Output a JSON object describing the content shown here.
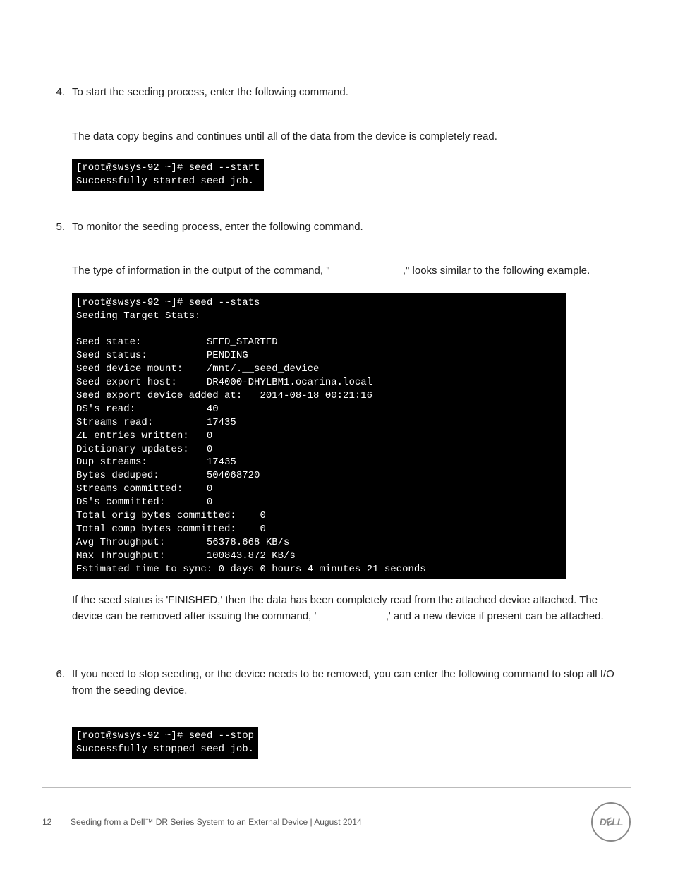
{
  "steps": [
    {
      "num": "4.",
      "intro": "To start the seeding process, enter the following command.",
      "note": "The data copy begins and continues until all of the data from the device is completely read.",
      "terminal": "[root@swsys-92 ~]# seed --start\nSuccessfully started seed job."
    },
    {
      "num": "5.",
      "intro": "To monitor the seeding process, enter the following command.",
      "note_pre": "The type of information in the output of the command, \"",
      "note_post": ",\" looks similar to the following example.",
      "terminal": "[root@swsys-92 ~]# seed --stats\nSeeding Target Stats:\n\nSeed state:           SEED_STARTED\nSeed status:          PENDING\nSeed device mount:    /mnt/.__seed_device\nSeed export host:     DR4000-DHYLBM1.ocarina.local\nSeed export device added at:   2014-08-18 00:21:16\nDS's read:            40\nStreams read:         17435\nZL entries written:   0\nDictionary updates:   0\nDup streams:          17435\nBytes deduped:        504068720\nStreams committed:    0\nDS's committed:       0\nTotal orig bytes committed:    0\nTotal comp bytes committed:    0\nAvg Throughput:       56378.668 KB/s\nMax Throughput:       100843.872 KB/s\nEstimated time to sync: 0 days 0 hours 4 minutes 21 seconds",
      "after_pre": "If the seed status is 'FINISHED,' then the data has been completely read from the attached device attached. The device can be removed after issuing the command, '",
      "after_post": ",' and a new device if present can be attached."
    },
    {
      "num": "6.",
      "intro": "If you need to stop seeding, or the device needs to be removed, you can enter the following command to stop all I/O from the seeding device.",
      "terminal": "[root@swsys-92 ~]# seed --stop\nSuccessfully stopped seed job."
    }
  ],
  "footer": {
    "page": "12",
    "title": "Seeding from a Dell™ DR Series System to an External Device | August 2014",
    "logo_d": "D",
    "logo_e": "E",
    "logo_l1": "L",
    "logo_l2": "L"
  }
}
